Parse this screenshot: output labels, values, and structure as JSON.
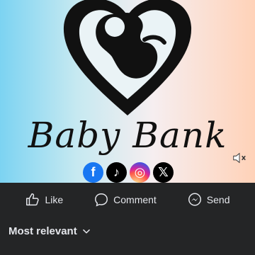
{
  "post": {
    "brand_name": "Baby Bank"
  },
  "socials": [
    {
      "icon": "facebook-icon",
      "glyph": "f",
      "color": "#1877f2"
    },
    {
      "icon": "tiktok-icon",
      "glyph": "♪",
      "color": "#000000"
    },
    {
      "icon": "instagram-icon",
      "glyph": "◎",
      "color": "#d6249f"
    },
    {
      "icon": "x-icon",
      "glyph": "𝕏",
      "color": "#000000"
    }
  ],
  "actions": {
    "like_label": "Like",
    "comment_label": "Comment",
    "send_label": "Send"
  },
  "comments": {
    "sort_label": "Most relevant"
  },
  "colors": {
    "bar_bg": "#242526",
    "text": "#e4e6eb"
  }
}
